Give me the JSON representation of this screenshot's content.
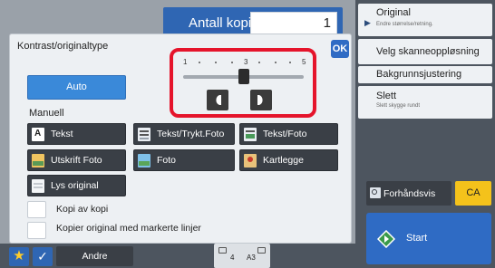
{
  "copies": {
    "label": "Antall kopier",
    "value": "1"
  },
  "right_menu": [
    {
      "title": "Original",
      "subtitle": "Endre størrelse/retning.",
      "arrow": true
    },
    {
      "title": "Velg skanneoppløsning",
      "subtitle": "",
      "arrow": false
    },
    {
      "title": "Bakgrunnsjustering",
      "subtitle": "",
      "arrow": false
    },
    {
      "title": "Slett",
      "subtitle": "Slett skygge rundt",
      "arrow": false
    }
  ],
  "dialog": {
    "title": "Kontrast/originaltype",
    "ok_label": "OK",
    "auto_label": "Auto",
    "manual_label": "Manuell",
    "slider": {
      "tick_labels": [
        "1",
        "3",
        "5"
      ],
      "value": 3,
      "min": 1,
      "max": 5,
      "decrease_icon": "contrast-decrease-icon",
      "increase_icon": "contrast-increase-icon"
    },
    "modes": [
      {
        "label": "Tekst",
        "icon": "text-document-icon"
      },
      {
        "label": "Tekst/Trykt.Foto",
        "icon": "text-printed-photo-icon"
      },
      {
        "label": "Tekst/Foto",
        "icon": "text-photo-icon"
      },
      {
        "label": "Utskrift Foto",
        "icon": "printed-photo-icon"
      },
      {
        "label": "Foto",
        "icon": "photo-icon"
      },
      {
        "label": "Kartlegge",
        "icon": "map-icon"
      },
      {
        "label": "Lys original",
        "icon": "light-original-icon"
      }
    ],
    "options": [
      {
        "label": "Kopi av kopi",
        "checked": false
      },
      {
        "label": "Kopier original med markerte linjer",
        "checked": false
      }
    ]
  },
  "bottom": {
    "andre_label": "Andre",
    "tray_number": "4",
    "paper_size": "A3"
  },
  "actions": {
    "preview_label": "Forhåndsvis",
    "ca_label": "CA",
    "start_label": "Start"
  },
  "colors": {
    "accent_blue": "#2f66b3",
    "highlight_red": "#e5142b",
    "ca_yellow": "#f4c21b",
    "dark_button": "#3a3f46"
  }
}
